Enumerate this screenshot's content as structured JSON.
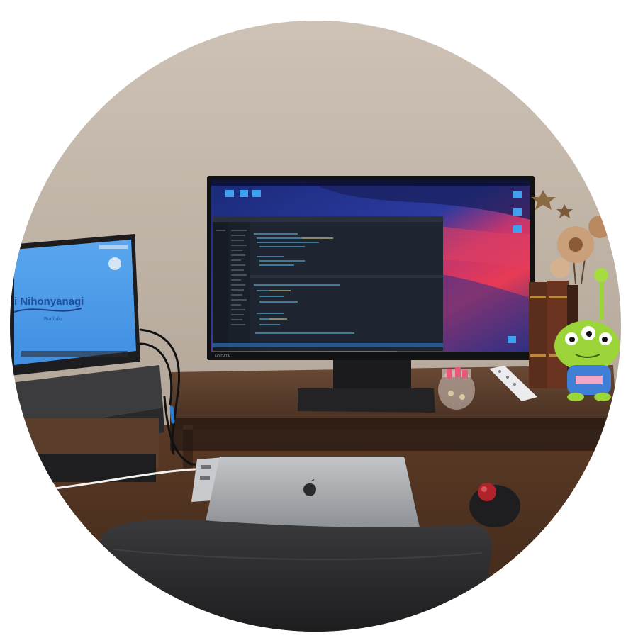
{
  "scene": {
    "left_laptop_screen": {
      "title_text": "i Nihonyanagi",
      "subtitle_text": "Portfolio"
    },
    "monitor": {
      "brand_text": "I-O DATA",
      "desktop_colors": [
        "#1b2a6b",
        "#c03a6e",
        "#e8355a",
        "#2a3b8f"
      ]
    },
    "macbook": {
      "color": "#b7b9bc"
    },
    "objects": [
      "desk-shelf",
      "external-monitor",
      "portable-monitor",
      "macbook-laptop",
      "usb-hub",
      "trackball-mouse",
      "remote-control",
      "glass-candy-jar",
      "stacked-books",
      "dried-flower-bouquet",
      "alien-figure",
      "office-chair"
    ]
  }
}
